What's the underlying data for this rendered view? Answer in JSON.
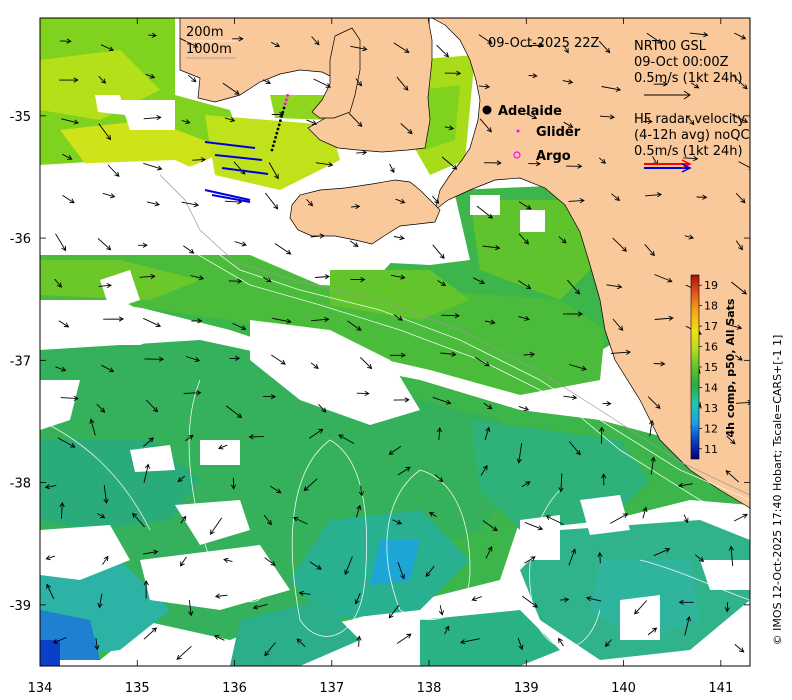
{
  "map": {
    "lon_ticks": [
      "134",
      "135",
      "136",
      "137",
      "138",
      "139",
      "140",
      "141"
    ],
    "lat_ticks": [
      "-35",
      "-36",
      "-37",
      "-38",
      "-39"
    ],
    "lon_range": [
      134,
      141.3
    ],
    "lat_range": [
      -39.5,
      -34.2
    ],
    "timestamp": "09-Oct-2025 22Z",
    "bathymetry_legend": [
      "200m",
      "1000m"
    ],
    "model_legend": {
      "line1": "NRT00 GSL",
      "line2": "09-Oct 00:00Z",
      "line3": "0.5m/s (1kt 24h)"
    },
    "radar_legend": {
      "line1": "HF radar velocity",
      "line2": "(4-12h avg) noQC",
      "line3": "0.5m/s (1kt 24h)"
    },
    "markers": {
      "adelaide": "Adelaide",
      "glider": "Glider",
      "argo": "Argo"
    },
    "colorbar": {
      "title": "4h comp, p50, All Sats",
      "ticks": [
        "19",
        "18",
        "17",
        "16",
        "15",
        "14",
        "13",
        "12",
        "11"
      ],
      "range": [
        10.5,
        19.5
      ]
    },
    "credit": "© IMOS 12-Oct-2025 17:40 Hobart; Tscale=CARS+[-1 1]",
    "colors": {
      "land": "#f9c89b",
      "glider": "#ff00ff",
      "argo": "#ff00ff",
      "radar_red": "#ff0000",
      "radar_blue": "#0000dd"
    }
  }
}
